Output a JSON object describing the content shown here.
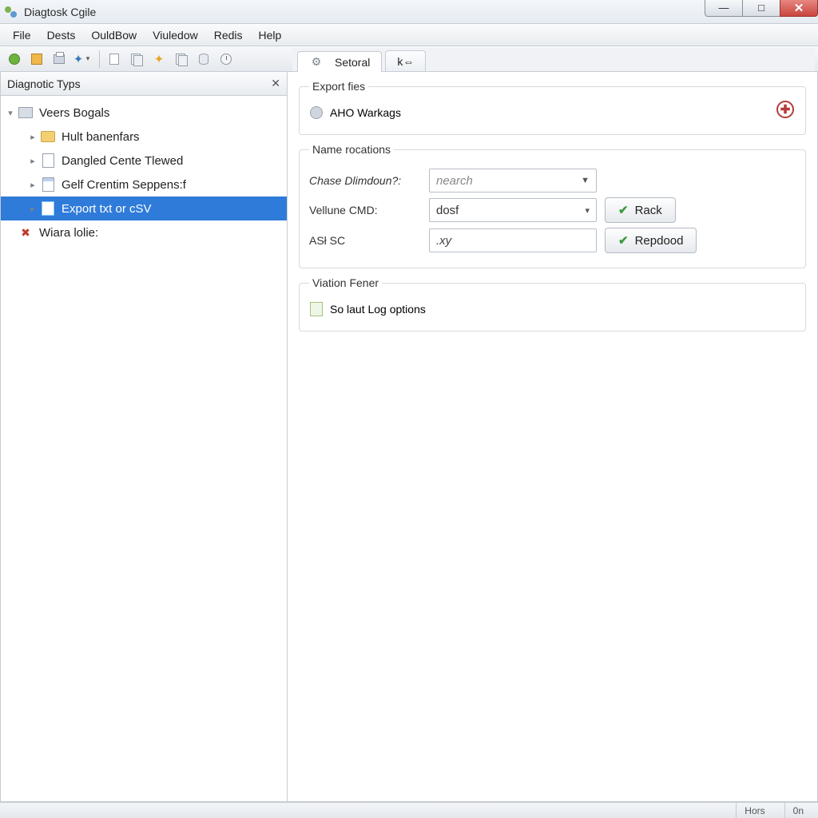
{
  "window": {
    "title": "Diagtosk Cgile"
  },
  "win_controls": {
    "min": "—",
    "max": "□",
    "close": "✕"
  },
  "menu": {
    "file": "File",
    "dests": "Dests",
    "ouldbow": "OuldBow",
    "viuledow": "Viuledow",
    "redis": "Redis",
    "help": "Help"
  },
  "tabs": {
    "active_label": "Setoral",
    "second_label": "k⇔"
  },
  "sidebar": {
    "title": "Diagnotic Typs",
    "root": "Veers Bogals",
    "items": [
      {
        "label": "Hult banenfars"
      },
      {
        "label": "Dangled Cente Tlewed"
      },
      {
        "label": "Gelf Crentim Seppens:f"
      },
      {
        "label": "Export txt or cSV"
      },
      {
        "label": "Wiara lolie:"
      }
    ]
  },
  "panel": {
    "export": {
      "legend": "Export fies",
      "row1": "AHO Warkags"
    },
    "name": {
      "legend": "Name rocations",
      "chase_label": "Chase Dlimdoun?:",
      "chase_value": "nearch",
      "vel_label": "Vellune CMD:",
      "vel_value": "dosf",
      "asp_label": "ASł SC",
      "asp_value": ".xy",
      "btn_rack": "Rack",
      "btn_repdood": "Repdood"
    },
    "viation": {
      "legend": "Viation Fener",
      "row1": "So laut Log options"
    }
  },
  "status": {
    "cell1": "Hors",
    "cell2": "0n"
  }
}
